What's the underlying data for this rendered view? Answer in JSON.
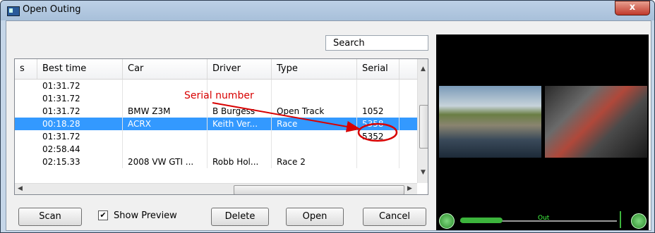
{
  "window": {
    "title": "Open Outing",
    "close_label": "x"
  },
  "search": {
    "placeholder": "Search",
    "value": ""
  },
  "table": {
    "columns": [
      "s",
      "Best time",
      "Car",
      "Driver",
      "Type",
      "Serial"
    ],
    "rows": [
      {
        "best_time": "01:31.72",
        "car": "",
        "driver": "",
        "type": "",
        "serial": ""
      },
      {
        "best_time": "01:31.72",
        "car": "",
        "driver": "",
        "type": "",
        "serial": ""
      },
      {
        "best_time": "01:31.72",
        "car": "BMW Z3M",
        "driver": "B Burgess",
        "type": "Open Track",
        "serial": "1052"
      },
      {
        "best_time": "00:18.28",
        "car": "ACRX",
        "driver": "Keith Ver...",
        "type": "Race",
        "serial": "5358",
        "selected": true
      },
      {
        "best_time": "01:31.72",
        "car": "",
        "driver": "",
        "type": "",
        "serial": "5352"
      },
      {
        "best_time": "02:58.44",
        "car": "",
        "driver": "",
        "type": "",
        "serial": ""
      },
      {
        "best_time": "02:15.33",
        "car": "2008 VW GTI ...",
        "driver": "Robb Hol...",
        "type": "Race 2",
        "serial": ""
      }
    ]
  },
  "annotation": {
    "label": "Serial number",
    "color": "#d80000"
  },
  "buttons": {
    "scan": "Scan",
    "show_preview": "Show Preview",
    "delete": "Delete",
    "open": "Open",
    "cancel": "Cancel"
  },
  "show_preview_checked": true,
  "player": {
    "out_label": "Out",
    "accent": "#3cb43c"
  },
  "icons": {
    "play": "play-icon",
    "volume": "volume-icon",
    "checkbox": "checkmark-icon"
  }
}
